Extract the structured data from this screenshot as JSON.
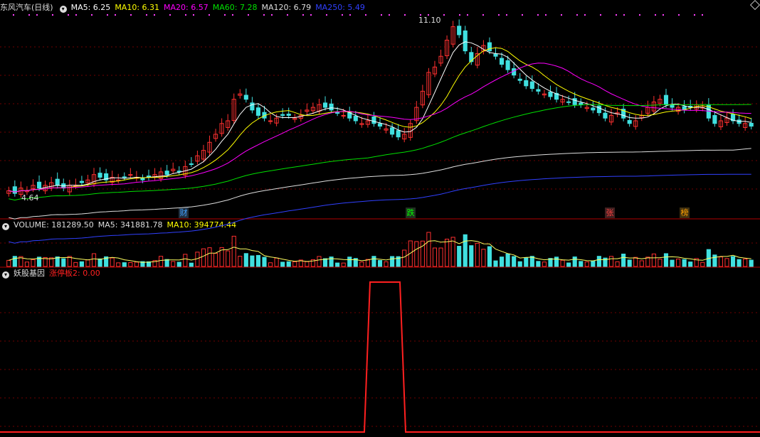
{
  "main": {
    "title": "东风汽车(日线)",
    "ma": [
      {
        "label": "MA5: 6.25",
        "color": "#ffffff"
      },
      {
        "label": "MA10: 6.31",
        "color": "#ffff00"
      },
      {
        "label": "MA20: 6.57",
        "color": "#ff00ff"
      },
      {
        "label": "MA60: 7.28",
        "color": "#00e000"
      },
      {
        "label": "MA120: 6.79",
        "color": "#dddddd"
      },
      {
        "label": "MA250: 5.49",
        "color": "#3040ff"
      }
    ],
    "high_label": "11.10",
    "low_label": "4.64",
    "badges": [
      {
        "text": "财",
        "color": "#40a0ff",
        "bg": "#203040"
      },
      {
        "text": "跌",
        "color": "#00ff00",
        "bg": "#203020"
      },
      {
        "text": "张",
        "color": "#ff4040",
        "bg": "#402020"
      },
      {
        "text": "榜",
        "color": "#ffa000",
        "bg": "#403010"
      }
    ]
  },
  "volume": {
    "labels": [
      {
        "label": "VOLUME: 181289.50",
        "color": "#dddddd"
      },
      {
        "label": "MA5: 341881.78",
        "color": "#dddddd"
      },
      {
        "label": "MA10: 394774.44",
        "color": "#ffff00"
      }
    ]
  },
  "indicator": {
    "title": "妖股基因",
    "value": "涨停板2: 0.00",
    "color": "#ff2020"
  },
  "chart_data": {
    "type": "candlestick",
    "closes": [
      4.8,
      4.7,
      4.9,
      4.8,
      5.0,
      4.9,
      5.0,
      5.1,
      5.0,
      4.9,
      5.0,
      5.0,
      5.1,
      5.2,
      5.4,
      5.3,
      5.2,
      5.3,
      5.2,
      5.3,
      5.4,
      5.3,
      5.2,
      5.3,
      5.4,
      5.5,
      5.4,
      5.6,
      5.5,
      5.7,
      5.8,
      6.1,
      6.3,
      6.6,
      6.9,
      7.3,
      7.4,
      8.2,
      8.4,
      8.2,
      7.8,
      7.6,
      7.5,
      7.4,
      7.5,
      7.6,
      7.6,
      7.5,
      7.6,
      7.8,
      7.9,
      8.0,
      7.9,
      7.8,
      7.7,
      7.6,
      7.5,
      7.4,
      7.3,
      7.4,
      7.3,
      7.2,
      7.1,
      6.9,
      6.8,
      6.9,
      7.3,
      7.9,
      8.5,
      9.2,
      9.4,
      9.8,
      10.4,
      10.9,
      10.6,
      10.0,
      9.6,
      9.9,
      10.2,
      10.0,
      9.8,
      9.5,
      9.3,
      9.1,
      8.9,
      8.7,
      8.6,
      8.5,
      8.4,
      8.3,
      8.2,
      8.2,
      8.1,
      8.0,
      8.0,
      7.9,
      7.8,
      7.7,
      7.5,
      7.6,
      7.7,
      7.5,
      7.3,
      7.4,
      7.6,
      7.9,
      8.1,
      8.2,
      8.0,
      7.9,
      7.9,
      7.8,
      7.9,
      8.0,
      7.9,
      7.5,
      7.3,
      7.4,
      7.5,
      7.4,
      7.3,
      7.3,
      7.2
    ],
    "high": 11.1,
    "low": 4.64
  }
}
